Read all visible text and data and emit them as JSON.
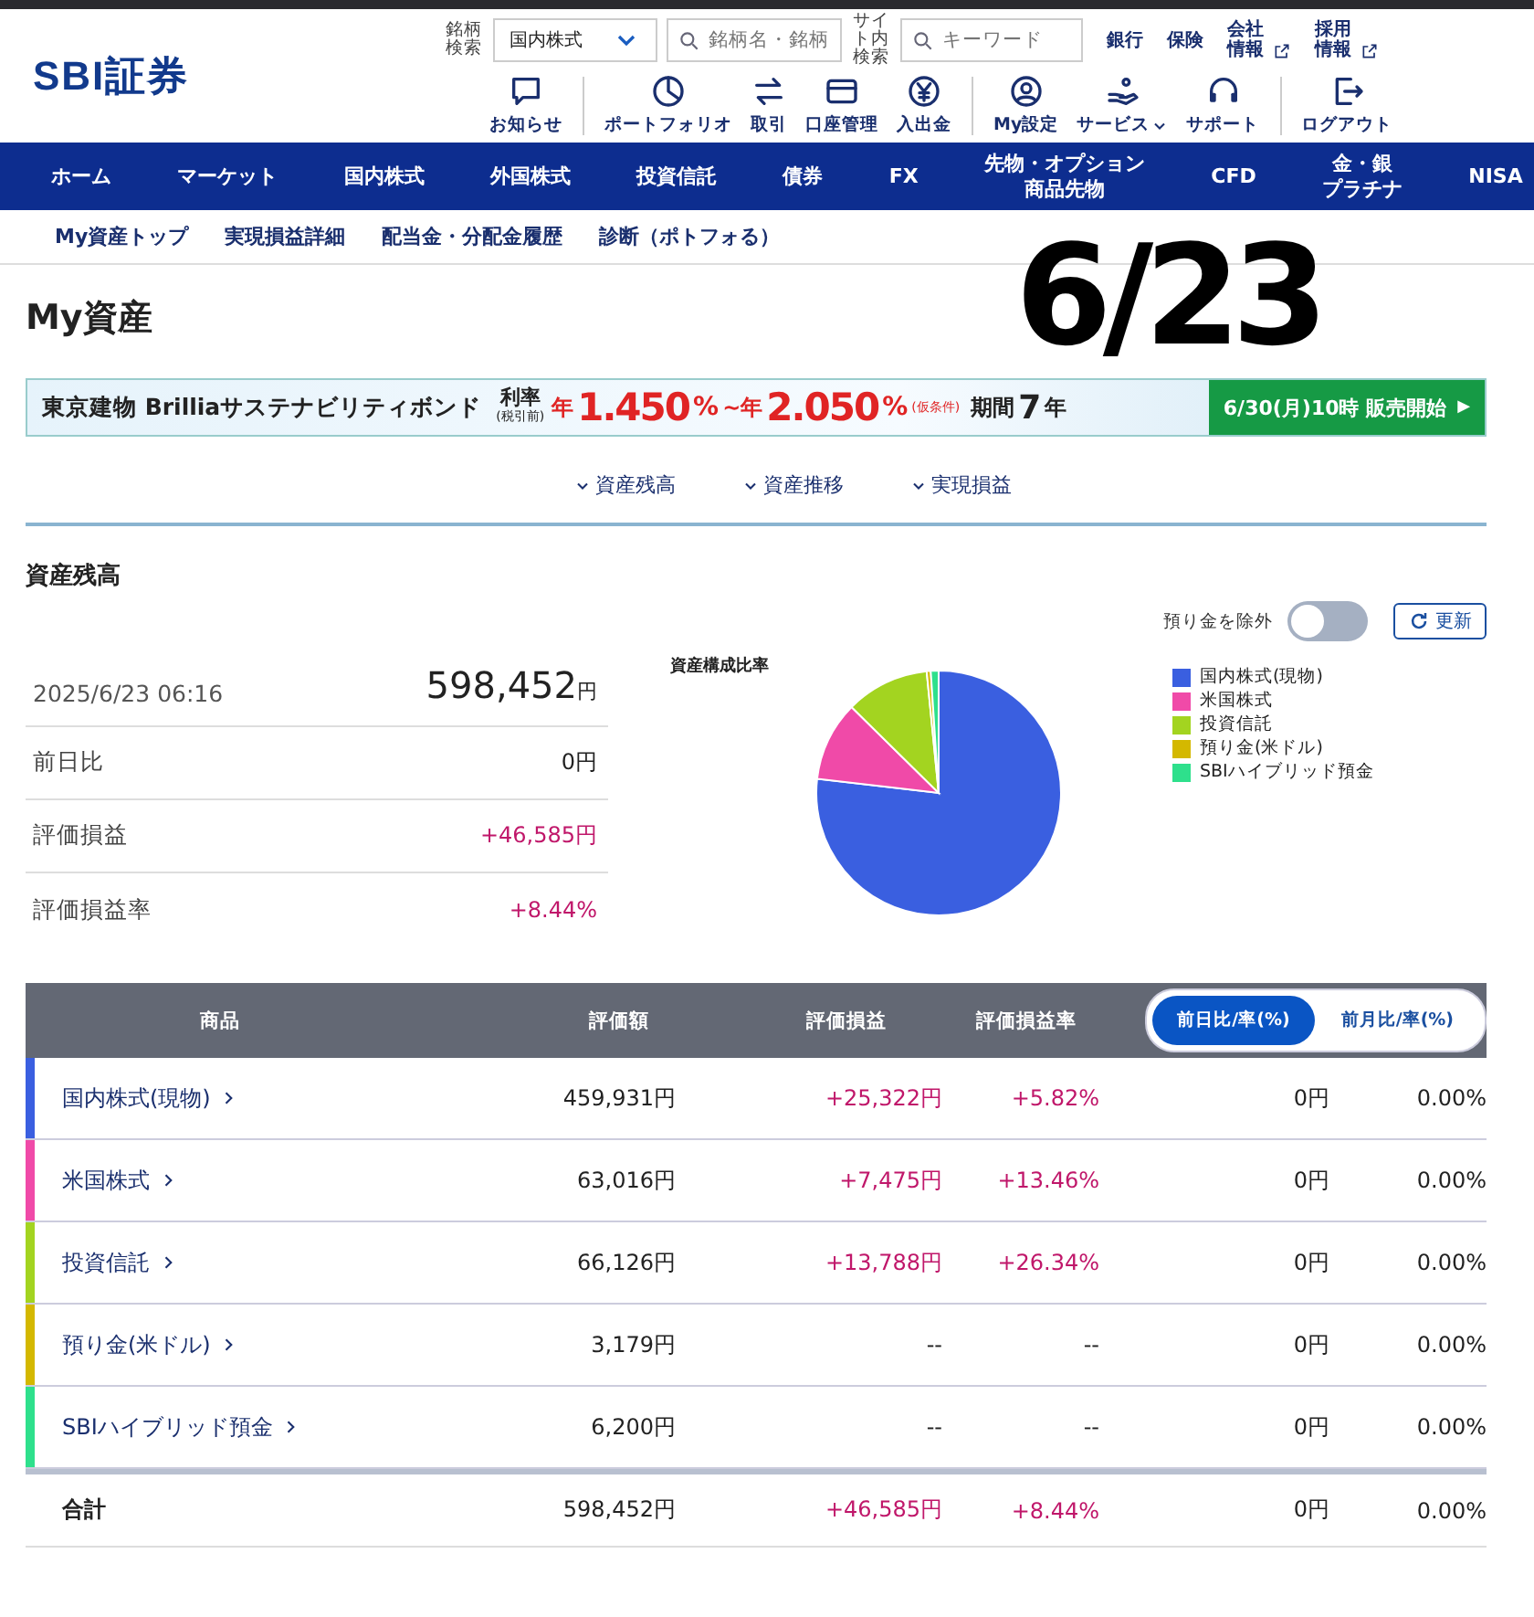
{
  "header": {
    "logo": "SBI証券",
    "stock_search": {
      "label": "銘柄検索",
      "market": "国内株式",
      "placeholder": "銘柄名・銘柄"
    },
    "site_search": {
      "label": "サイト内検索",
      "placeholder": "キーワード"
    },
    "links": [
      {
        "label": "銀行",
        "external": false
      },
      {
        "label": "保険",
        "external": false
      },
      {
        "label": "会社情報",
        "external": true
      },
      {
        "label": "採用情報",
        "external": true
      }
    ],
    "tools": [
      {
        "kind": "notice",
        "label": "お知らせ",
        "divider": true
      },
      {
        "kind": "portfolio",
        "label": "ポートフォリオ",
        "divider": false
      },
      {
        "kind": "trade",
        "label": "取引",
        "divider": false
      },
      {
        "kind": "account",
        "label": "口座管理",
        "divider": false
      },
      {
        "kind": "deposit",
        "label": "入出金",
        "divider": true
      },
      {
        "kind": "settings",
        "label": "My設定",
        "divider": false
      },
      {
        "kind": "service",
        "label": "サービス",
        "divider": false,
        "caret": true
      },
      {
        "kind": "support",
        "label": "サポート",
        "divider": true
      },
      {
        "kind": "logout",
        "label": "ログアウト",
        "divider": false
      }
    ]
  },
  "nav": [
    [
      "ホーム"
    ],
    [
      "マーケット"
    ],
    [
      "国内株式"
    ],
    [
      "外国株式"
    ],
    [
      "投資信託"
    ],
    [
      "債券"
    ],
    [
      "FX"
    ],
    [
      "先物・オプション",
      "商品先物"
    ],
    [
      "CFD"
    ],
    [
      "金・銀",
      "プラチナ"
    ],
    [
      "NISA"
    ]
  ],
  "subnav": [
    "My資産トップ",
    "実現損益詳細",
    "配当金・分配金履歴",
    "診断（ポトフォる）"
  ],
  "annotation": "6/23",
  "page_title": "My資産",
  "banner": {
    "product": "東京建物 Brilliaサステナビリティボンド",
    "rate_label": "利率",
    "rate_note": "(税引前)",
    "rate_parts": [
      {
        "kind": "unit",
        "text": "年"
      },
      {
        "kind": "number",
        "text": "1.450"
      },
      {
        "kind": "pct",
        "text": "%"
      },
      {
        "kind": "unit",
        "text": "~年"
      },
      {
        "kind": "number",
        "text": "2.050"
      },
      {
        "kind": "pct",
        "text": "%"
      },
      {
        "kind": "note",
        "text": "(仮条件)"
      }
    ],
    "term_label": "期間",
    "term_value": "7",
    "term_unit": "年",
    "cta": "6/30(月)10時 販売開始",
    "cta_arrow": "▶"
  },
  "anchors": [
    "資産残高",
    "資産推移",
    "実現損益"
  ],
  "section_title": "資産残高",
  "exclude_toggle": {
    "label": "預り金を除外",
    "on": false
  },
  "refresh": "更新",
  "summary": {
    "timestamp": "2025/6/23 06:16",
    "total": "598,452",
    "unit": "円",
    "rows": [
      {
        "label": "前日比",
        "value": "0円",
        "positive": false
      },
      {
        "label": "評価損益",
        "value": "+46,585円",
        "positive": true
      },
      {
        "label": "評価損益率",
        "value": "+8.44%",
        "positive": true
      }
    ]
  },
  "chart_title": "資産構成比率",
  "legend": [
    {
      "label": "国内株式(現物)",
      "color": "#3a5fe0"
    },
    {
      "label": "米国株式",
      "color": "#f04aa8"
    },
    {
      "label": "投資信託",
      "color": "#a3d420"
    },
    {
      "label": "預り金(米ドル)",
      "color": "#d4b800"
    },
    {
      "label": "SBIハイブリッド預金",
      "color": "#2ee08c"
    }
  ],
  "table": {
    "columns": [
      "商品",
      "評価額",
      "評価損益",
      "評価損益率"
    ],
    "compare": [
      {
        "label": "前日比/率(%)",
        "selected": true
      },
      {
        "label": "前月比/率(%)",
        "selected": false
      }
    ],
    "rows": [
      {
        "name": "国内株式(現物)",
        "color": "#3a5fe0",
        "amount": "459,931円",
        "gain": "+25,322円",
        "rate": "+5.82%",
        "positive": true,
        "change": "0円",
        "change_rate": "0.00%"
      },
      {
        "name": "米国株式",
        "color": "#f04aa8",
        "amount": "63,016円",
        "gain": "+7,475円",
        "rate": "+13.46%",
        "positive": true,
        "change": "0円",
        "change_rate": "0.00%"
      },
      {
        "name": "投資信託",
        "color": "#a3d420",
        "amount": "66,126円",
        "gain": "+13,788円",
        "rate": "+26.34%",
        "positive": true,
        "change": "0円",
        "change_rate": "0.00%"
      },
      {
        "name": "預り金(米ドル)",
        "color": "#d4b800",
        "amount": "3,179円",
        "gain": "--",
        "rate": "--",
        "positive": false,
        "change": "0円",
        "change_rate": "0.00%"
      },
      {
        "name": "SBIハイブリッド預金",
        "color": "#2ee08c",
        "amount": "6,200円",
        "gain": "--",
        "rate": "--",
        "positive": false,
        "change": "0円",
        "change_rate": "0.00%"
      }
    ],
    "total": {
      "name": "合計",
      "amount": "598,452円",
      "gain": "+46,585円",
      "rate": "+8.44%",
      "positive": true,
      "change": "0円",
      "change_rate": "0.00%"
    }
  }
}
